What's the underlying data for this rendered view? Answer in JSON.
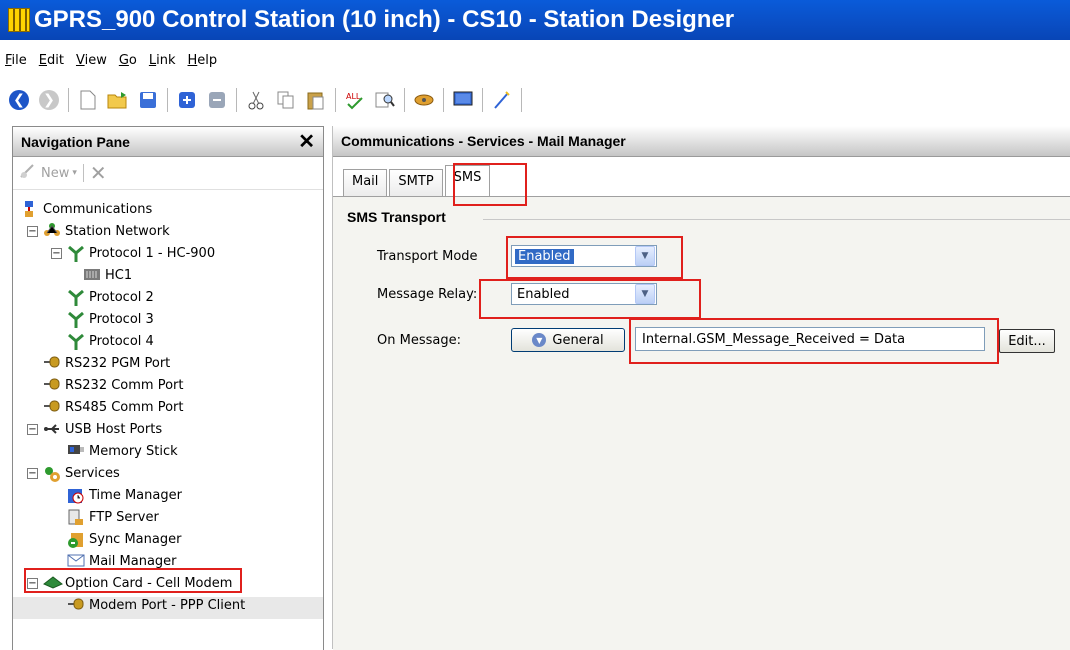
{
  "window": {
    "title": "GPRS_900 Control Station (10 inch) - CS10 - Station Designer"
  },
  "menu": [
    "File",
    "Edit",
    "View",
    "Go",
    "Link",
    "Help"
  ],
  "toolbar": {
    "icons": [
      "back-icon",
      "forward-icon",
      "new-icon",
      "open-icon",
      "save-icon",
      "import-icon",
      "export-icon",
      "cut-icon",
      "copy-icon",
      "paste-icon",
      "spellcheck-icon",
      "find-icon",
      "link-icon",
      "monitor-icon",
      "wand-icon"
    ]
  },
  "nav": {
    "title": "Navigation Pane",
    "new_label": "New",
    "tree": [
      {
        "label": "Communications",
        "icon": "communications-icon"
      },
      {
        "label": "Station Network",
        "icon": "network-icon"
      },
      {
        "label": "Protocol 1 - HC-900",
        "icon": "protocol-icon"
      },
      {
        "label": "HC1",
        "icon": "device-icon"
      },
      {
        "label": "Protocol 2",
        "icon": "protocol-icon"
      },
      {
        "label": "Protocol 3",
        "icon": "protocol-icon"
      },
      {
        "label": "Protocol 4",
        "icon": "protocol-icon"
      },
      {
        "label": "RS232 PGM Port",
        "icon": "port-icon"
      },
      {
        "label": "RS232 Comm Port",
        "icon": "port-icon"
      },
      {
        "label": "RS485 Comm Port",
        "icon": "port-icon"
      },
      {
        "label": "USB Host Ports",
        "icon": "usb-icon"
      },
      {
        "label": "Memory Stick",
        "icon": "memory-stick-icon"
      },
      {
        "label": "Services",
        "icon": "services-icon"
      },
      {
        "label": "Time Manager",
        "icon": "time-manager-icon"
      },
      {
        "label": "FTP Server",
        "icon": "ftp-server-icon"
      },
      {
        "label": "Sync Manager",
        "icon": "sync-manager-icon"
      },
      {
        "label": "Mail Manager",
        "icon": "mail-manager-icon"
      },
      {
        "label": "Option Card - Cell Modem",
        "icon": "option-card-icon"
      },
      {
        "label": "Modem Port - PPP Client",
        "icon": "port-icon"
      }
    ]
  },
  "main": {
    "header": "Communications - Services - Mail Manager",
    "tabs": [
      "Mail",
      "SMTP",
      "SMS"
    ],
    "group_title": "SMS Transport",
    "transport_mode": {
      "label": "Transport Mode",
      "value": "Enabled"
    },
    "message_relay": {
      "label": "Message Relay:",
      "value": "Enabled"
    },
    "on_message": {
      "label": "On Message:",
      "button": "General",
      "expression": "Internal.GSM_Message_Received = Data",
      "edit": "Edit..."
    }
  },
  "colors": {
    "titlebar": "#0a5bd9",
    "highlight": "#e0201c",
    "selection": "#316ac5"
  }
}
